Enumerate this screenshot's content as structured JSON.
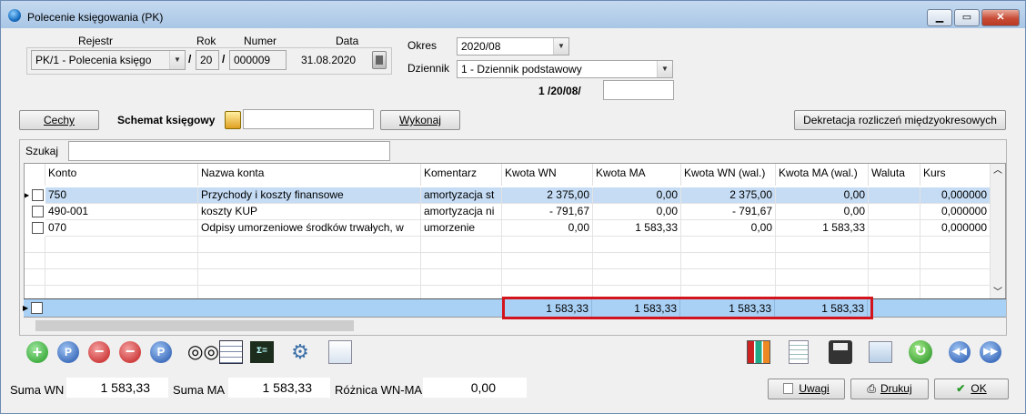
{
  "window": {
    "title": "Polecenie księgowania (PK)"
  },
  "header": {
    "rejestr_label": "Rejestr",
    "rok_label": "Rok",
    "numer_label": "Numer",
    "data_label": "Data",
    "rejestr_value": "PK/1  - Polecenia księgo",
    "rok_value": "20",
    "numer_value": "000009",
    "data_value": "31.08.2020",
    "slash": "/",
    "okres_label": "Okres",
    "okres_value": "2020/08",
    "dziennik_label": "Dziennik",
    "dziennik_value": "1  - Dziennik podstawowy",
    "dziennik_number": "1 /20/08/"
  },
  "toolbar_top": {
    "cechy": "Cechy",
    "schemat_label": "Schemat księgowy",
    "wykonaj": "Wykonaj",
    "dekretacja": "Dekretacja rozliczeń międzyokresowych"
  },
  "search": {
    "label": "Szukaj",
    "value": ""
  },
  "table": {
    "columns": [
      "Konto",
      "Nazwa konta",
      "Komentarz",
      "Kwota WN",
      "Kwota MA",
      "Kwota WN (wal.)",
      "Kwota MA (wal.)",
      "Waluta",
      "Kurs"
    ],
    "rows": [
      {
        "konto": "750",
        "nazwa": "Przychody i koszty finansowe",
        "komentarz": "amortyzacja st",
        "wn": "2 375,00",
        "ma": "0,00",
        "wn_wal": "2 375,00",
        "ma_wal": "0,00",
        "waluta": "",
        "kurs": "0,000000"
      },
      {
        "konto": "490-001",
        "nazwa": "koszty KUP",
        "komentarz": "amortyzacja ni",
        "wn": "- 791,67",
        "ma": "0,00",
        "wn_wal": "- 791,67",
        "ma_wal": "0,00",
        "waluta": "",
        "kurs": "0,000000"
      },
      {
        "konto": "070",
        "nazwa": "Odpisy umorzeniowe środków trwałych, w",
        "komentarz": "umorzenie",
        "wn": "0,00",
        "ma": "1 583,33",
        "wn_wal": "0,00",
        "ma_wal": "1 583,33",
        "waluta": "",
        "kurs": "0,000000"
      }
    ],
    "totals": {
      "wn": "1 583,33",
      "ma": "1 583,33",
      "wn_wal": "1 583,33",
      "ma_wal": "1 583,33"
    }
  },
  "footer": {
    "suma_wn_label": "Suma WN",
    "suma_wn": "1 583,33",
    "suma_ma_label": "Suma MA",
    "suma_ma": "1 583,33",
    "roznica_label": "Różnica WN-MA",
    "roznica": "0,00",
    "uwagi": "Uwagi",
    "drukuj": "Drukuj",
    "ok": "OK"
  }
}
